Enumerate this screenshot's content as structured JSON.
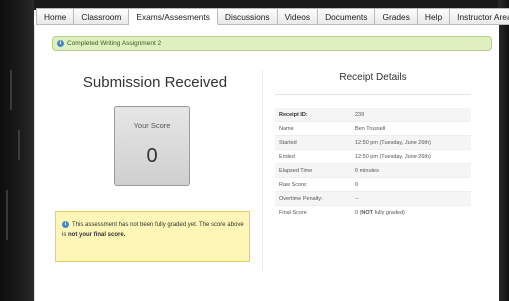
{
  "nav": {
    "tabs": [
      {
        "label": "Home"
      },
      {
        "label": "Classroom"
      },
      {
        "label": "Exams/Assesments"
      },
      {
        "label": "Discussions"
      },
      {
        "label": "Videos"
      },
      {
        "label": "Documents"
      },
      {
        "label": "Grades"
      },
      {
        "label": "Help"
      },
      {
        "label": "Instructor Area"
      }
    ],
    "active_tab": "Exams/Assesments"
  },
  "notice": {
    "text": "Completed Writing Assignment 2",
    "icon": "info-icon"
  },
  "submission": {
    "title": "Submission Received",
    "score_label": "Your Score",
    "score_value": "0"
  },
  "warning": {
    "text_part1": "This assessment has not been fully graded yet. The score above is ",
    "text_bold": "not your final score.",
    "icon": "info-icon"
  },
  "receipt": {
    "title": "Receipt Details",
    "rows": [
      {
        "label": "Receipt ID:",
        "value": "239"
      },
      {
        "label": "Name",
        "value": "Ben Trussell"
      },
      {
        "label": "Started",
        "value": "12:50 pm (Tuesday, June 26th)"
      },
      {
        "label": "Ended",
        "value": "12:50 pm (Tuesday, June 26th)"
      },
      {
        "label": "Elapsed Time",
        "value": "0 minutes"
      },
      {
        "label": "Raw Score:",
        "value": "0"
      },
      {
        "label": "Overtime Penalty:",
        "value": "--"
      },
      {
        "label": "Final Score",
        "value_pre": "0 (",
        "value_bold": "NOT",
        "value_post": " fully graded)"
      }
    ]
  },
  "colors": {
    "notice_bg": "#dff0c0",
    "warning_bg": "#fdf6b7",
    "score_box_bg": "#d9d9d9",
    "info_icon": "#4a87c9"
  }
}
